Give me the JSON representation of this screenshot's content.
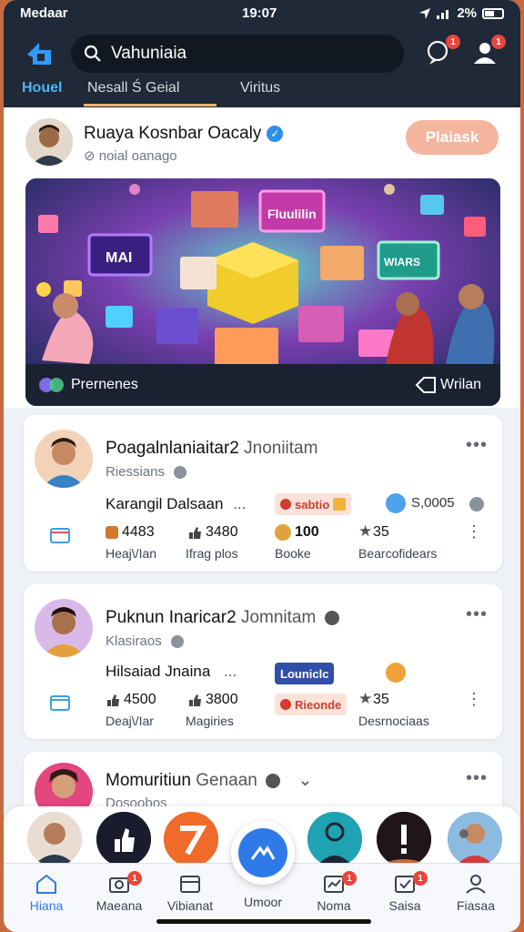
{
  "status": {
    "carrier": "Medaar",
    "time": "19:07",
    "battery": "2%"
  },
  "header": {
    "search_value": "Vahuniaia",
    "icons": [
      "logo-icon",
      "search-icon",
      "chat-icon",
      "profile-icon"
    ],
    "chat_badge": "1",
    "profile_badge": "1",
    "tabs": [
      {
        "label": "Houel",
        "active": true
      },
      {
        "label": "Nesall Ś Geial",
        "active": false
      },
      {
        "label": "Viritus",
        "active": false
      }
    ]
  },
  "profile": {
    "name": "Ruaya Kosnbar Oacaly",
    "subtitle": "⊘ noial oanago",
    "follow_label": "Plaiask",
    "banner_caption": "Prernenes",
    "banner_action": "Wrilan",
    "banner_signs": [
      "Fluulilin",
      "MAI",
      "WIARS"
    ]
  },
  "cards": [
    {
      "title": "Poagalnlaniaitar2",
      "title_extra": "Jnoniitam",
      "subtitle": "Riessians",
      "line_left": "Karangil  Dalsaan",
      "line_dots": "...",
      "pill_label": "sabtio",
      "pill_right": "S,0005",
      "stats": [
        {
          "value": "4483",
          "label": "Heaj\\/Ian"
        },
        {
          "value": "3480",
          "label": "Ifrag plos"
        },
        {
          "value": "100",
          "label": "Booke"
        },
        {
          "value": "35",
          "label": "Bearcofidears"
        }
      ]
    },
    {
      "title": "Puknun Inaricar2",
      "title_extra": "Jomnitam",
      "subtitle": "Klasiraos",
      "line_left": "Hilsaiad  Jnaina",
      "line_dots": "...",
      "pill_label": "Louniclc",
      "pill_label_2": "Rieonde",
      "stats": [
        {
          "value": "4500",
          "label": "Deaj\\/Iar"
        },
        {
          "value": "3800",
          "label": "Magiries"
        },
        {
          "value": "35",
          "label": "Desrnociaas"
        }
      ]
    },
    {
      "title": "Momuritiun",
      "title_extra": "Genaan",
      "subtitle": "Dosoobos"
    }
  ],
  "nav": [
    {
      "label": "Hiana",
      "active": true
    },
    {
      "label": "Maeana",
      "badge": "1"
    },
    {
      "label": "Vibianat"
    },
    {
      "label": "Umoor"
    },
    {
      "label": "Noma",
      "badge": "1"
    },
    {
      "label": "Saisa",
      "badge": "1"
    },
    {
      "label": "Fiasaa"
    }
  ],
  "colors": {
    "accent": "#2f7ae8",
    "header_bg": "#1f2937",
    "follow_button": "#f4b59f",
    "badge": "#e8453c"
  }
}
